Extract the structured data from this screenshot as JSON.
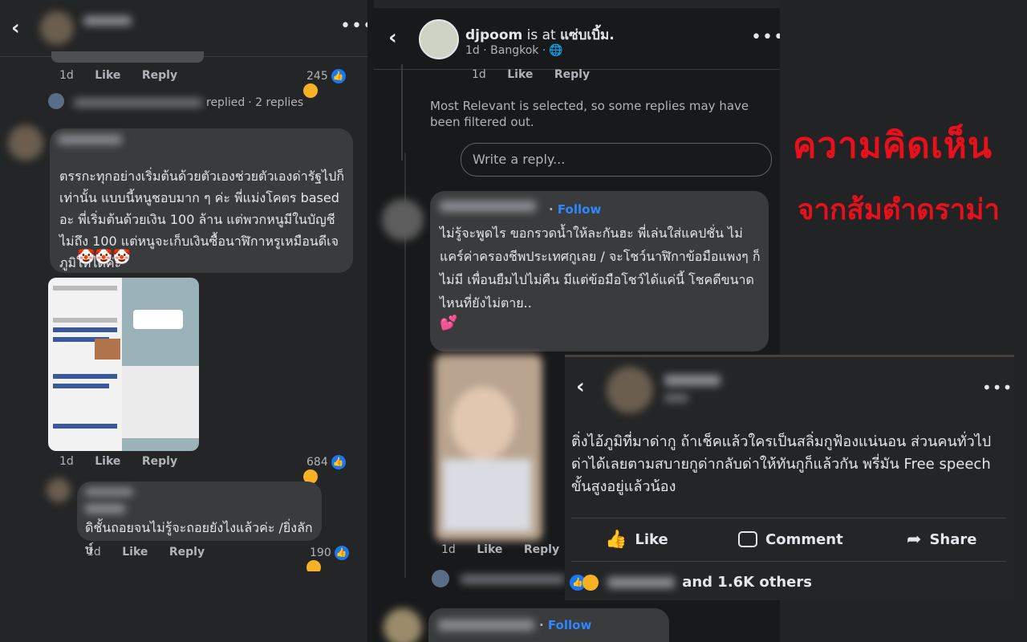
{
  "left": {
    "c1": {
      "time": "1d",
      "like": "Like",
      "reply": "Reply",
      "count": "245"
    },
    "replied": {
      "text": "replied",
      "replies": "2 replies"
    },
    "c2": {
      "text": "ตรรกะทุกอย่างเริ่มต้นด้วยตัวเองช่วยตัวเองด่ารัฐไปก็เท่านั้น แบบนี้หนูชอบมาก ๆ ค่ะ พี่แม่งโคตร based อะ พี่เริ่มต้นด้วยเงิน 100 ล้าน แต่พวกหนูมีในบัญชีไม่ถึง 100 แต่หนูจะเก็บเงินซื้อนาฬิกาหรูเหมือนดีเจภูมิให้ได้ค่ะ",
      "emoji": "🤡🤡🤡"
    },
    "c3": {
      "time": "1d",
      "like": "Like",
      "reply": "Reply",
      "count": "684"
    },
    "c4": {
      "text": "ดิชั้นถอยจนไม่รู้จะถอยยังไงแล้วค่ะ /ยิ่งลักษ์"
    },
    "c5": {
      "time": "1d",
      "like": "Like",
      "reply": "Reply",
      "count": "190"
    }
  },
  "mid": {
    "header": {
      "name": "djpoom",
      "is_at": "is at",
      "place": "แซ่บเบิ้ม.",
      "sub": "1d · Bangkok ·"
    },
    "c0": {
      "time": "1d",
      "like": "Like",
      "reply": "Reply"
    },
    "filter_note": "Most Relevant is selected, so some replies may have been filtered out.",
    "write_placeholder": "Write a reply...",
    "comment": {
      "follow": "Follow",
      "text": "ไม่รู้จะพูดไร ขอกรวดน้ำให้ละกันฮะ พี่เล่นใส่แคปชั่น ไม่แคร์ค่าครองชีพประเทศกูเลย / จะโชว์นาฬิกาข้อมือแพงๆ ก็ไม่มี เพื่อนยืมไปไม่คืน มีแต่ข้อมือโชว์ได้แค่นี้ โชคดีขนาดไหนที่ยังไม่ตาย..",
      "emoji": "💕"
    },
    "c6": {
      "time": "1d",
      "like": "Like",
      "reply": "Reply"
    },
    "last": {
      "follow": "Follow"
    }
  },
  "overlay": {
    "text": "ติ่งไอ้ภูมิที่มาด่ากู ถ้าเช็คแล้วใครเป็นสลิ่มกูฟ้องแน่นอน ส่วนคนทั่วไปด่าได้เลยตามสบายกูด่ากลับด่าให้ทันกูก็แล้วกัน พรี่มัน Free speech ขั้นสูงอยู่แล้วน้อง",
    "like": "Like",
    "comment": "Comment",
    "share": "Share",
    "others": "and 1.6K others"
  },
  "title": {
    "line1": "ความคิดเห็น",
    "line2": "จากส้มตำดราม่า"
  },
  "colors": {
    "accent": "#2d88ff",
    "title_red": "#e8101a",
    "bubble": "#3a3b3c",
    "bg": "#242526"
  }
}
